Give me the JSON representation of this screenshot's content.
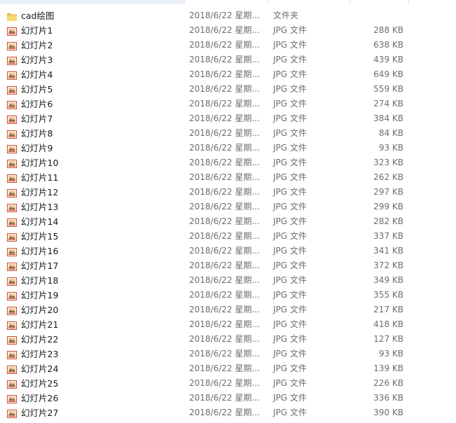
{
  "files": [
    {
      "name": "cad绘图",
      "date": "2018/6/22 星期...",
      "type": "文件夹",
      "size": "",
      "icon": "folder-icon"
    },
    {
      "name": "幻灯片1",
      "date": "2018/6/22 星期...",
      "type": "JPG 文件",
      "size": "288 KB",
      "icon": "jpg-file-icon"
    },
    {
      "name": "幻灯片2",
      "date": "2018/6/22 星期...",
      "type": "JPG 文件",
      "size": "638 KB",
      "icon": "jpg-file-icon"
    },
    {
      "name": "幻灯片3",
      "date": "2018/6/22 星期...",
      "type": "JPG 文件",
      "size": "439 KB",
      "icon": "jpg-file-icon"
    },
    {
      "name": "幻灯片4",
      "date": "2018/6/22 星期...",
      "type": "JPG 文件",
      "size": "649 KB",
      "icon": "jpg-file-icon"
    },
    {
      "name": "幻灯片5",
      "date": "2018/6/22 星期...",
      "type": "JPG 文件",
      "size": "559 KB",
      "icon": "jpg-file-icon"
    },
    {
      "name": "幻灯片6",
      "date": "2018/6/22 星期...",
      "type": "JPG 文件",
      "size": "274 KB",
      "icon": "jpg-file-icon"
    },
    {
      "name": "幻灯片7",
      "date": "2018/6/22 星期...",
      "type": "JPG 文件",
      "size": "384 KB",
      "icon": "jpg-file-icon"
    },
    {
      "name": "幻灯片8",
      "date": "2018/6/22 星期...",
      "type": "JPG 文件",
      "size": "84 KB",
      "icon": "jpg-file-icon"
    },
    {
      "name": "幻灯片9",
      "date": "2018/6/22 星期...",
      "type": "JPG 文件",
      "size": "93 KB",
      "icon": "jpg-file-icon"
    },
    {
      "name": "幻灯片10",
      "date": "2018/6/22 星期...",
      "type": "JPG 文件",
      "size": "323 KB",
      "icon": "jpg-file-icon"
    },
    {
      "name": "幻灯片11",
      "date": "2018/6/22 星期...",
      "type": "JPG 文件",
      "size": "262 KB",
      "icon": "jpg-file-icon"
    },
    {
      "name": "幻灯片12",
      "date": "2018/6/22 星期...",
      "type": "JPG 文件",
      "size": "297 KB",
      "icon": "jpg-file-icon"
    },
    {
      "name": "幻灯片13",
      "date": "2018/6/22 星期...",
      "type": "JPG 文件",
      "size": "299 KB",
      "icon": "jpg-file-icon"
    },
    {
      "name": "幻灯片14",
      "date": "2018/6/22 星期...",
      "type": "JPG 文件",
      "size": "282 KB",
      "icon": "jpg-file-icon"
    },
    {
      "name": "幻灯片15",
      "date": "2018/6/22 星期...",
      "type": "JPG 文件",
      "size": "337 KB",
      "icon": "jpg-file-icon"
    },
    {
      "name": "幻灯片16",
      "date": "2018/6/22 星期...",
      "type": "JPG 文件",
      "size": "341 KB",
      "icon": "jpg-file-icon"
    },
    {
      "name": "幻灯片17",
      "date": "2018/6/22 星期...",
      "type": "JPG 文件",
      "size": "372 KB",
      "icon": "jpg-file-icon"
    },
    {
      "name": "幻灯片18",
      "date": "2018/6/22 星期...",
      "type": "JPG 文件",
      "size": "349 KB",
      "icon": "jpg-file-icon"
    },
    {
      "name": "幻灯片19",
      "date": "2018/6/22 星期...",
      "type": "JPG 文件",
      "size": "355 KB",
      "icon": "jpg-file-icon"
    },
    {
      "name": "幻灯片20",
      "date": "2018/6/22 星期...",
      "type": "JPG 文件",
      "size": "217 KB",
      "icon": "jpg-file-icon"
    },
    {
      "name": "幻灯片21",
      "date": "2018/6/22 星期...",
      "type": "JPG 文件",
      "size": "418 KB",
      "icon": "jpg-file-icon"
    },
    {
      "name": "幻灯片22",
      "date": "2018/6/22 星期...",
      "type": "JPG 文件",
      "size": "127 KB",
      "icon": "jpg-file-icon"
    },
    {
      "name": "幻灯片23",
      "date": "2018/6/22 星期...",
      "type": "JPG 文件",
      "size": "93 KB",
      "icon": "jpg-file-icon"
    },
    {
      "name": "幻灯片24",
      "date": "2018/6/22 星期...",
      "type": "JPG 文件",
      "size": "139 KB",
      "icon": "jpg-file-icon"
    },
    {
      "name": "幻灯片25",
      "date": "2018/6/22 星期...",
      "type": "JPG 文件",
      "size": "226 KB",
      "icon": "jpg-file-icon"
    },
    {
      "name": "幻灯片26",
      "date": "2018/6/22 星期...",
      "type": "JPG 文件",
      "size": "336 KB",
      "icon": "jpg-file-icon"
    },
    {
      "name": "幻灯片27",
      "date": "2018/6/22 星期...",
      "type": "JPG 文件",
      "size": "390 KB",
      "icon": "jpg-file-icon"
    }
  ],
  "colors": {
    "folder": "#f8d775",
    "folder_dark": "#e0b540",
    "jpg_frame": "#c94a2b",
    "header_selected": "#ebf1f8"
  }
}
